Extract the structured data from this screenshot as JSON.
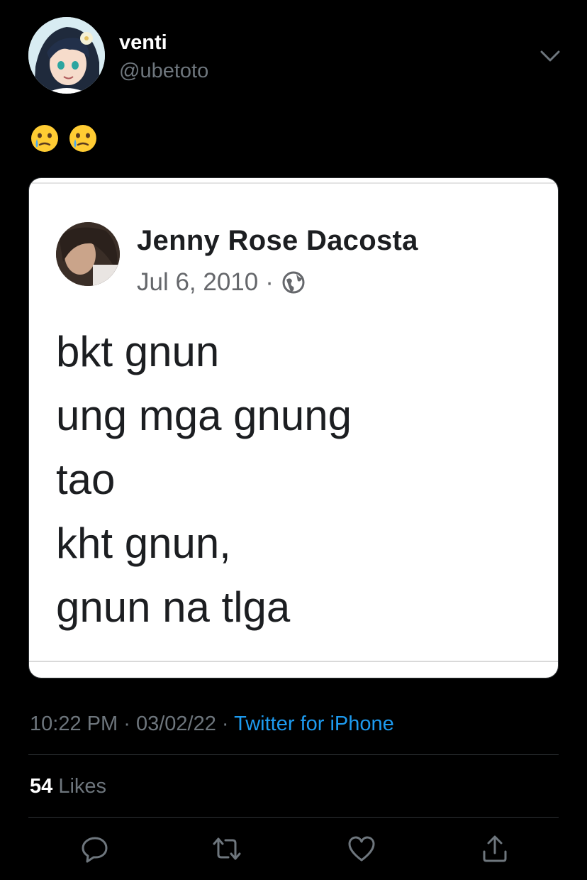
{
  "author": {
    "display_name": "venti",
    "handle": "@ubetoto",
    "avatar_icon": "avatar-anime-character"
  },
  "tweet": {
    "emojis": [
      "face-holding-back-tears-icon",
      "face-holding-back-tears-icon"
    ]
  },
  "embedded_post": {
    "name": "Jenny Rose Dacosta",
    "date": "Jul 6, 2010",
    "separator": "·",
    "privacy_icon": "globe-icon",
    "lines": [
      "bkt gnun",
      "ung mga gnung",
      "tao",
      "kht gnun,",
      "gnun na tlga"
    ]
  },
  "meta": {
    "time": "10:22 PM",
    "separator": "·",
    "date": "03/02/22",
    "source": "Twitter for iPhone"
  },
  "engagement": {
    "likes_count": "54",
    "likes_label": "Likes"
  },
  "actions": [
    "reply-icon",
    "retweet-icon",
    "like-icon",
    "share-icon"
  ],
  "colors": {
    "background": "#000000",
    "secondary_text": "#6e767d",
    "link": "#1d9bf0",
    "divider": "#2f3336"
  }
}
